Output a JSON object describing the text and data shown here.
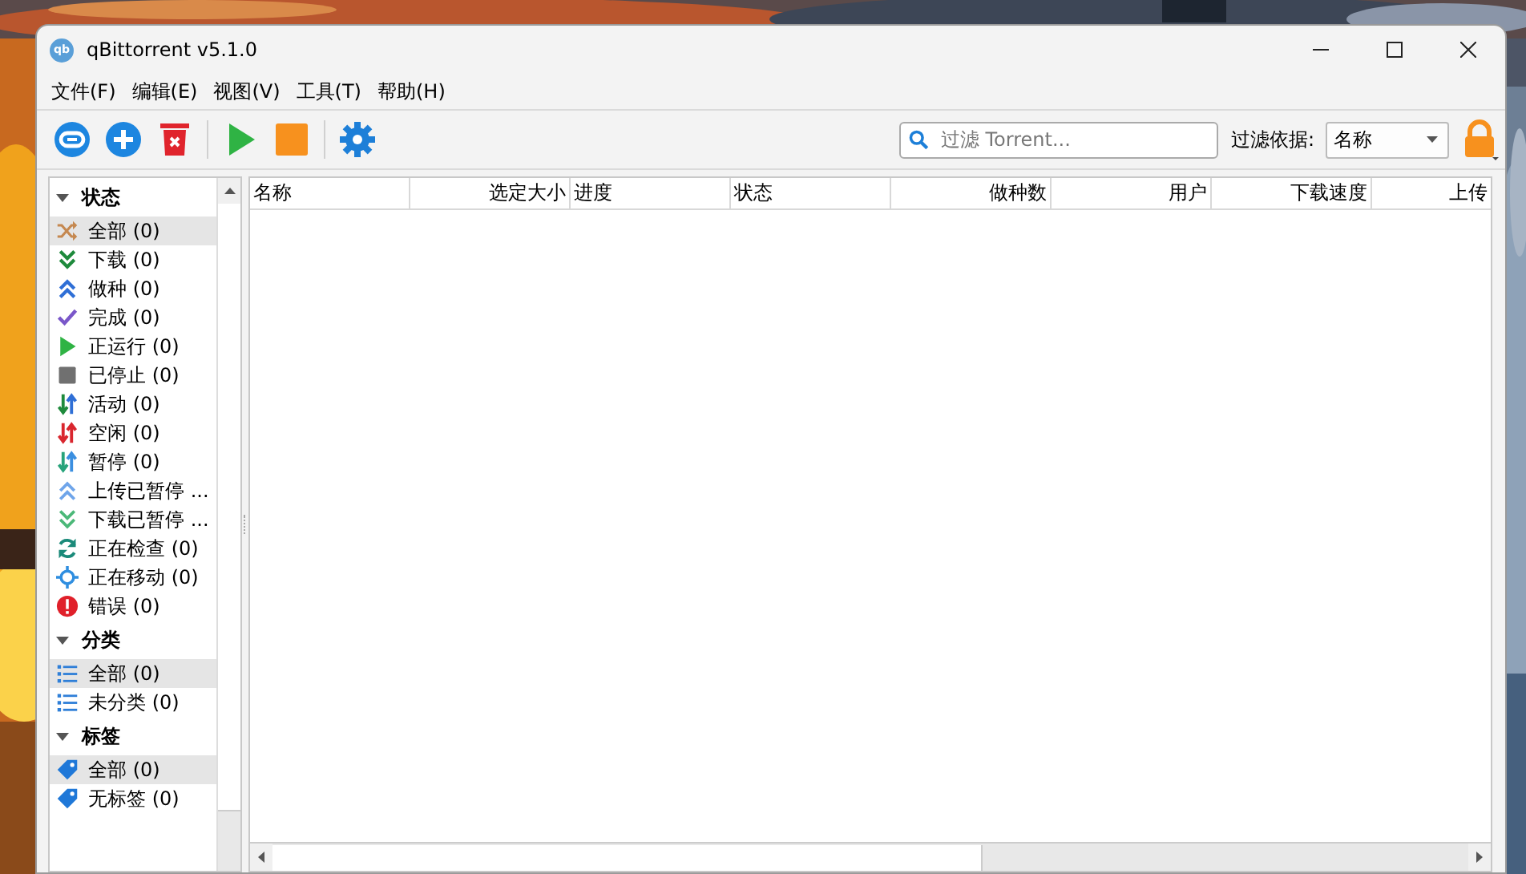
{
  "window": {
    "title": "qBittorrent v5.1.0",
    "icon_text": "qb"
  },
  "menu": [
    "文件(F)",
    "编辑(E)",
    "视图(V)",
    "工具(T)",
    "帮助(H)"
  ],
  "toolbar": {
    "search": {
      "placeholder": "过滤 Torrent..."
    },
    "filter_label": "过滤依据:",
    "filter_value": "名称"
  },
  "sidebar": {
    "sections": [
      {
        "title": "状态",
        "expanded": true,
        "items": [
          {
            "label": "全部 (0)",
            "selected": true
          },
          {
            "label": "下载 (0)",
            "selected": false
          },
          {
            "label": "做种 (0)",
            "selected": false
          },
          {
            "label": "完成 (0)",
            "selected": false
          },
          {
            "label": "正运行 (0)",
            "selected": false
          },
          {
            "label": "已停止 (0)",
            "selected": false
          },
          {
            "label": "活动 (0)",
            "selected": false
          },
          {
            "label": "空闲 (0)",
            "selected": false
          },
          {
            "label": "暂停 (0)",
            "selected": false
          },
          {
            "label": "上传已暂停 ...",
            "selected": false
          },
          {
            "label": "下载已暂停 ...",
            "selected": false
          },
          {
            "label": "正在检查 (0)",
            "selected": false
          },
          {
            "label": "正在移动 (0)",
            "selected": false
          },
          {
            "label": "错误 (0)",
            "selected": false
          }
        ]
      },
      {
        "title": "分类",
        "expanded": true,
        "items": [
          {
            "label": "全部 (0)",
            "selected": true
          },
          {
            "label": "未分类 (0)",
            "selected": false
          }
        ]
      },
      {
        "title": "标签",
        "expanded": true,
        "items": [
          {
            "label": "全部 (0)",
            "selected": true
          },
          {
            "label": "无标签 (0)",
            "selected": false
          }
        ]
      }
    ]
  },
  "table": {
    "columns": [
      "名称",
      "选定大小",
      "进度",
      "状态",
      "做种数",
      "用户",
      "下载速度",
      "上传"
    ]
  }
}
